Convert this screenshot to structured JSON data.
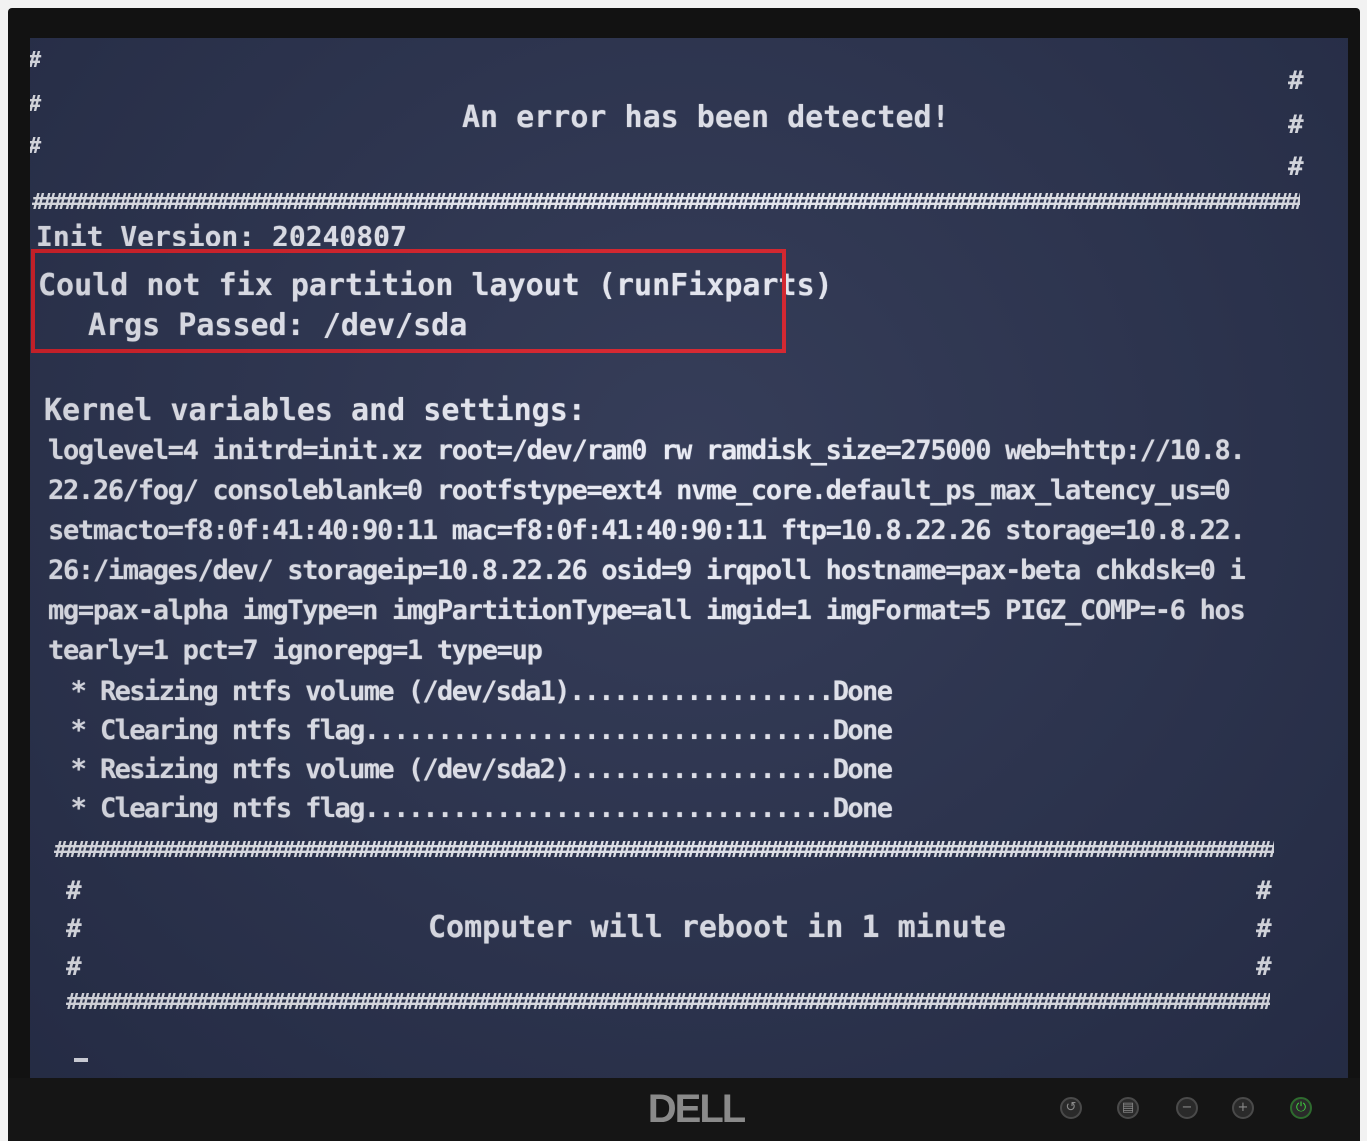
{
  "screen": {
    "header_title": "An error has been detected!",
    "init_version": "Init Version: 20240807",
    "error_line": "Could not fix partition layout (runFixparts)",
    "args_line": "Args Passed: /dev/sda",
    "kernel_heading": "Kernel variables and settings:",
    "kernel_lines": [
      "loglevel=4 initrd=init.xz root=/dev/ram0 rw ramdisk_size=275000 web=http://10.8.",
      "22.26/fog/ consoleblank=0 rootfstype=ext4 nvme_core.default_ps_max_latency_us=0",
      "setmacto=f8:0f:41:40:90:11 mac=f8:0f:41:40:90:11 ftp=10.8.22.26 storage=10.8.22.",
      "26:/images/dev/ storageip=10.8.22.26 osid=9 irqpoll hostname=pax-beta chkdsk=0 i",
      "mg=pax-alpha imgType=n imgPartitionType=all imgid=1 imgFormat=5 PIGZ_COMP=-6 hos",
      "tearly=1 pct=7 ignorepg=1 type=up"
    ],
    "progress_lines": [
      " * Resizing ntfs volume (/dev/sda1)..................Done",
      " * Clearing ntfs flag................................Done",
      " * Resizing ntfs volume (/dev/sda2)..................Done",
      " * Clearing ntfs flag................................Done"
    ],
    "footer_message": "Computer will reboot in 1 minute",
    "hash_char": "#"
  },
  "monitor": {
    "brand": "DELL",
    "buttons": [
      "input-source",
      "menu",
      "minus",
      "plus",
      "power"
    ],
    "power_led_color": "#3fd23f"
  },
  "colors": {
    "screen_bg": "#2b3350",
    "text": "#e8eaf4",
    "highlight_box": "#d8202a"
  }
}
